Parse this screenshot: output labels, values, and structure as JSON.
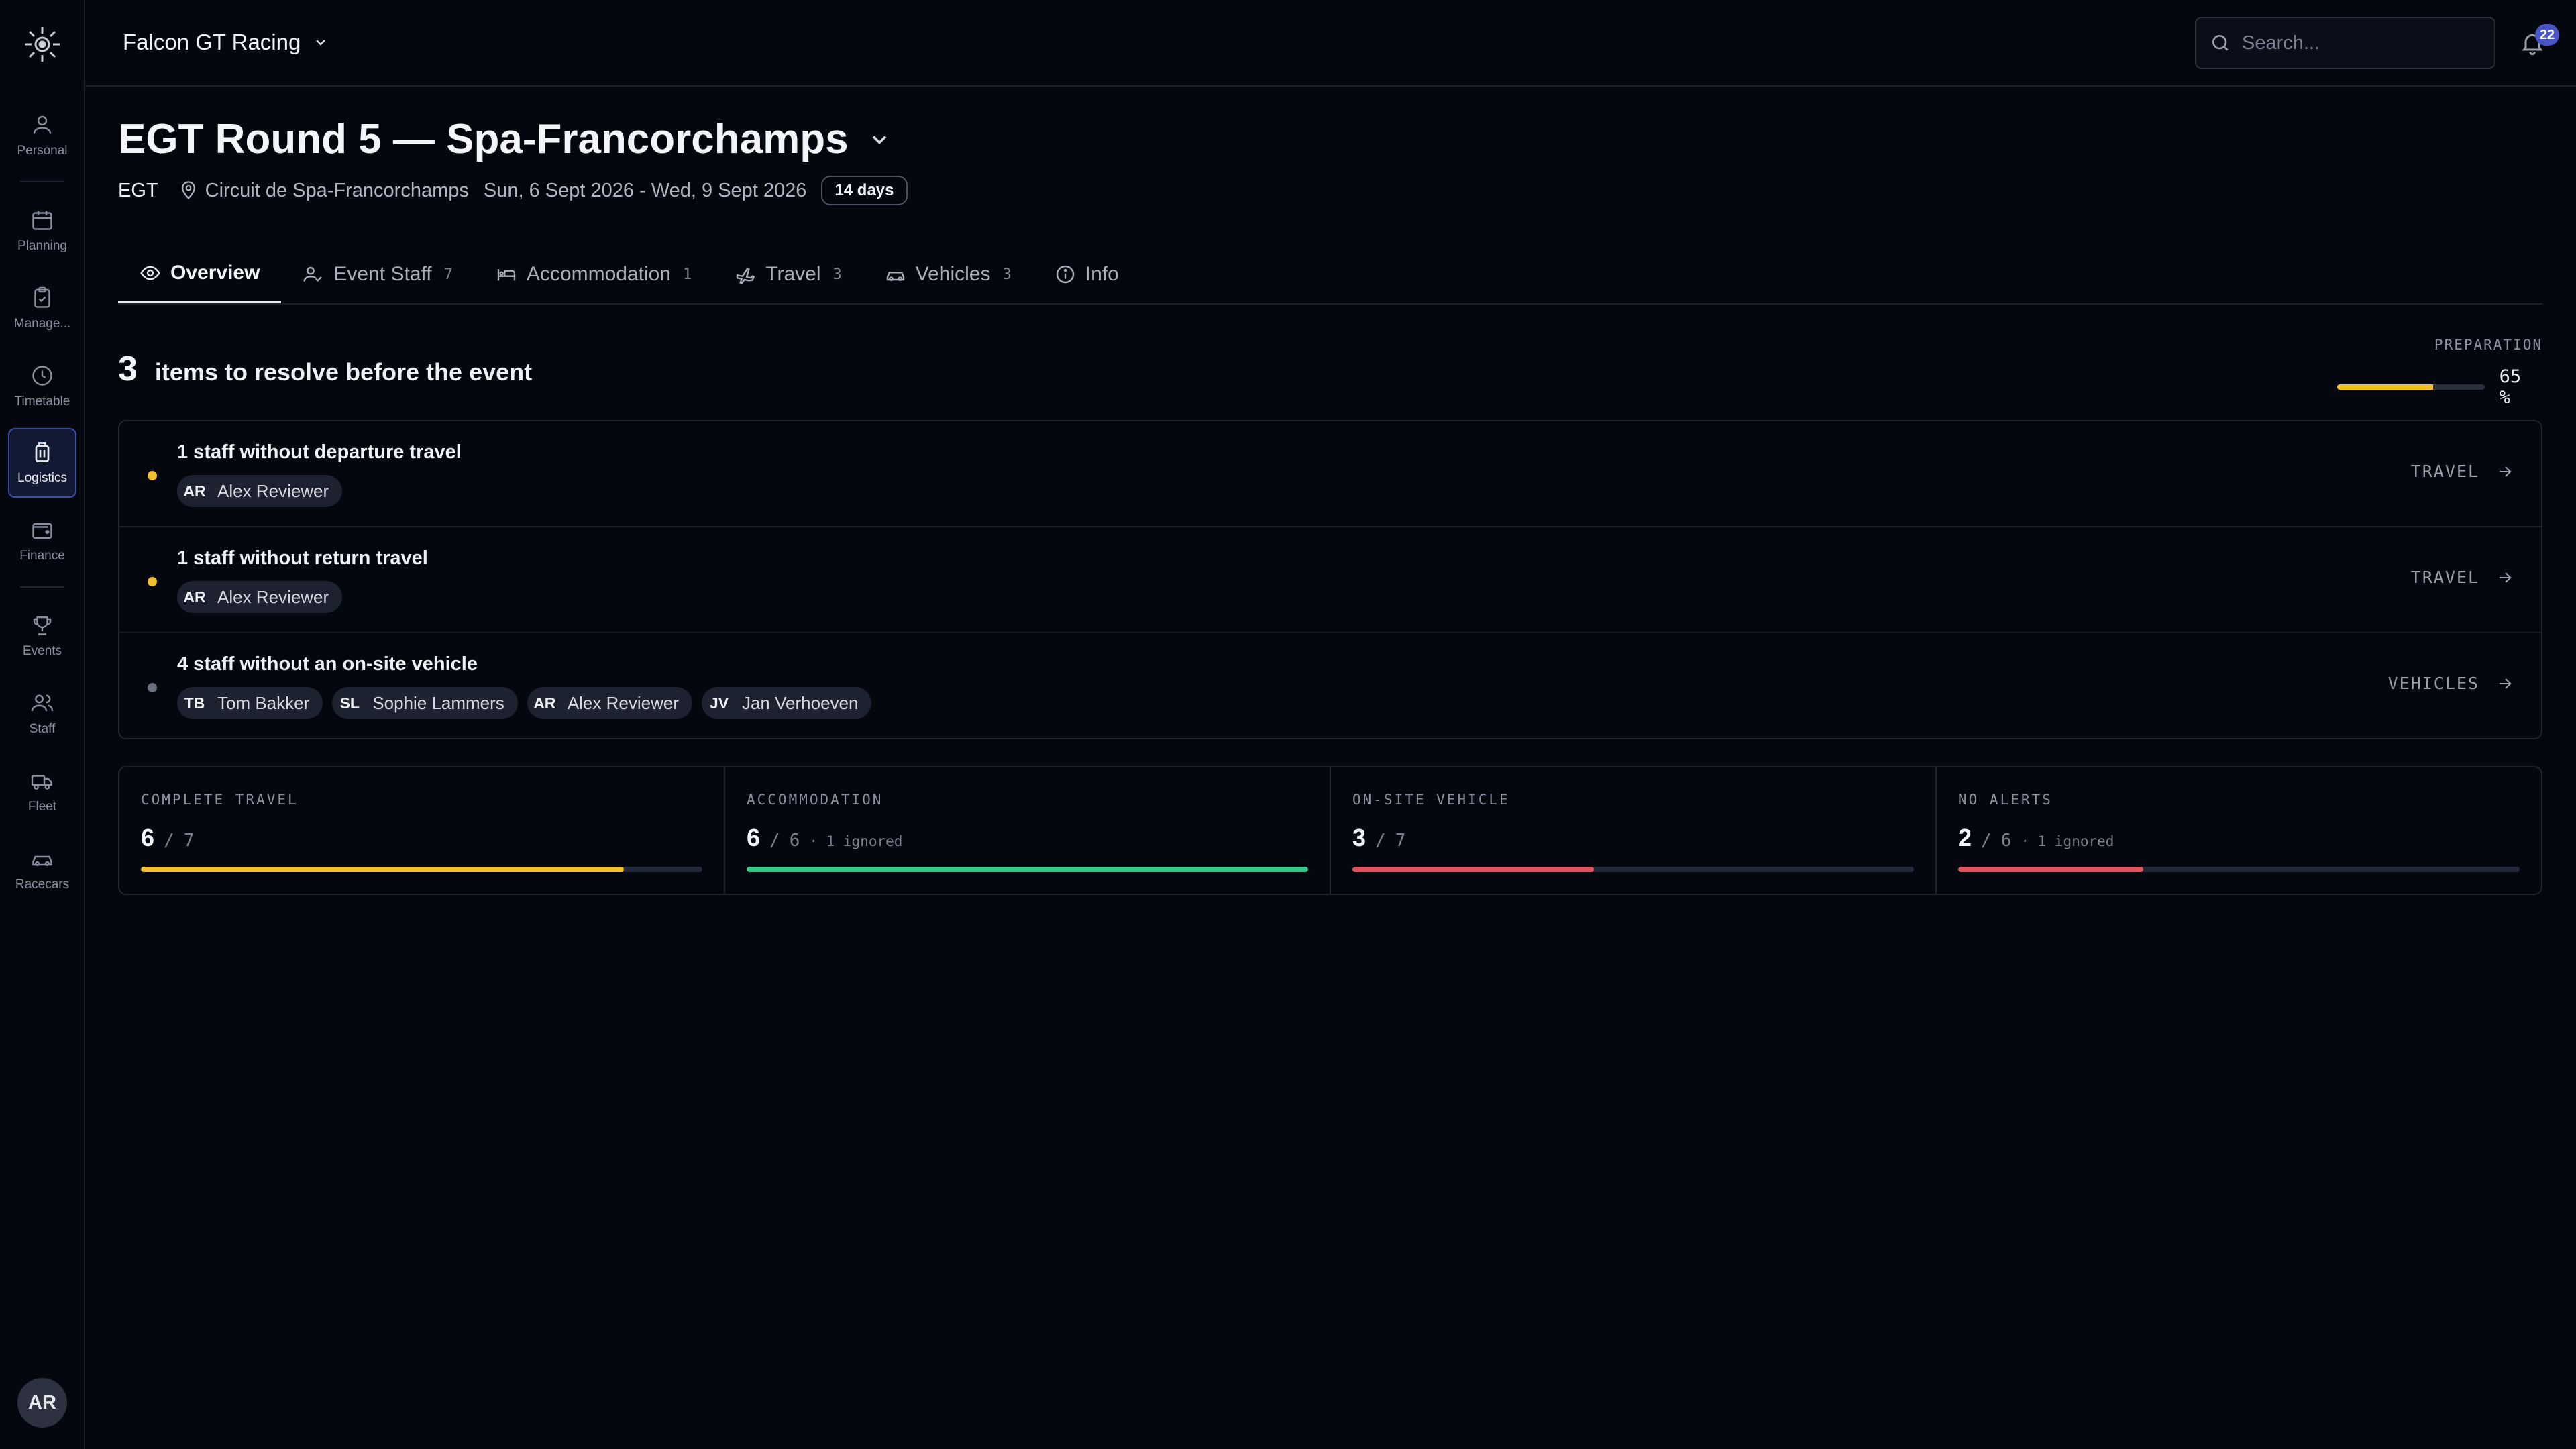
{
  "colors": {
    "accent_yellow": "#f2bf2f",
    "accent_green": "#34c98a",
    "accent_red": "#e0545e",
    "dot_muted": "#6b7080",
    "badge": "#4a55c8"
  },
  "sidebar": {
    "items": [
      {
        "label": "Personal",
        "icon": "user-icon"
      },
      {
        "label": "Planning",
        "icon": "calendar-icon"
      },
      {
        "label": "Manage...",
        "icon": "clipboard-icon"
      },
      {
        "label": "Timetable",
        "icon": "clock-icon"
      },
      {
        "label": "Logistics",
        "icon": "luggage-icon",
        "active": true
      },
      {
        "label": "Finance",
        "icon": "wallet-icon"
      },
      {
        "label": "Events",
        "icon": "trophy-icon"
      },
      {
        "label": "Staff",
        "icon": "users-icon"
      },
      {
        "label": "Fleet",
        "icon": "truck-icon"
      },
      {
        "label": "Racecars",
        "icon": "car-icon"
      }
    ],
    "avatar": "AR"
  },
  "topbar": {
    "org": "Falcon GT Racing",
    "search_placeholder": "Search...",
    "notifications": "22"
  },
  "event": {
    "title": "EGT Round 5 — Spa-Francorchamps",
    "series": "EGT",
    "location": "Circuit de Spa-Francorchamps",
    "dates": "Sun, 6 Sept 2026 - Wed, 9 Sept 2026",
    "duration": "14 days"
  },
  "tabs": [
    {
      "label": "Overview",
      "count": "",
      "icon": "eye-icon",
      "active": true
    },
    {
      "label": "Event Staff",
      "count": "7",
      "icon": "user-check-icon"
    },
    {
      "label": "Accommodation",
      "count": "1",
      "icon": "bed-icon"
    },
    {
      "label": "Travel",
      "count": "3",
      "icon": "plane-icon"
    },
    {
      "label": "Vehicles",
      "count": "3",
      "icon": "car-icon"
    },
    {
      "label": "Info",
      "count": "",
      "icon": "info-icon"
    }
  ],
  "summary": {
    "count": "3",
    "text": "items to resolve before the event",
    "prep_label": "PREPARATION",
    "prep_pct_text": "65 %",
    "prep_fraction": 0.65
  },
  "issues": [
    {
      "title": "1 staff without departure travel",
      "link": "TRAVEL",
      "dot": "yellow",
      "staff": [
        {
          "ini": "AR",
          "name": "Alex Reviewer"
        }
      ]
    },
    {
      "title": "1 staff without return travel",
      "link": "TRAVEL",
      "dot": "yellow",
      "staff": [
        {
          "ini": "AR",
          "name": "Alex Reviewer"
        }
      ]
    },
    {
      "title": "4 staff without an on-site vehicle",
      "link": "VEHICLES",
      "dot": "muted",
      "staff": [
        {
          "ini": "TB",
          "name": "Tom Bakker"
        },
        {
          "ini": "SL",
          "name": "Sophie Lammers"
        },
        {
          "ini": "AR",
          "name": "Alex Reviewer"
        },
        {
          "ini": "JV",
          "name": "Jan Verhoeven"
        }
      ]
    }
  ],
  "metrics": [
    {
      "label": "COMPLETE TRAVEL",
      "value": "6",
      "total": "7",
      "ignored": "",
      "fraction": 0.86,
      "color": "#f2bf2f"
    },
    {
      "label": "ACCOMMODATION",
      "value": "6",
      "total": "6",
      "ignored": "· 1 ignored",
      "fraction": 1.0,
      "color": "#34c98a"
    },
    {
      "label": "ON-SITE VEHICLE",
      "value": "3",
      "total": "7",
      "ignored": "",
      "fraction": 0.43,
      "color": "#e0545e"
    },
    {
      "label": "NO ALERTS",
      "value": "2",
      "total": "6",
      "ignored": "· 1 ignored",
      "fraction": 0.33,
      "color": "#e0545e"
    }
  ]
}
